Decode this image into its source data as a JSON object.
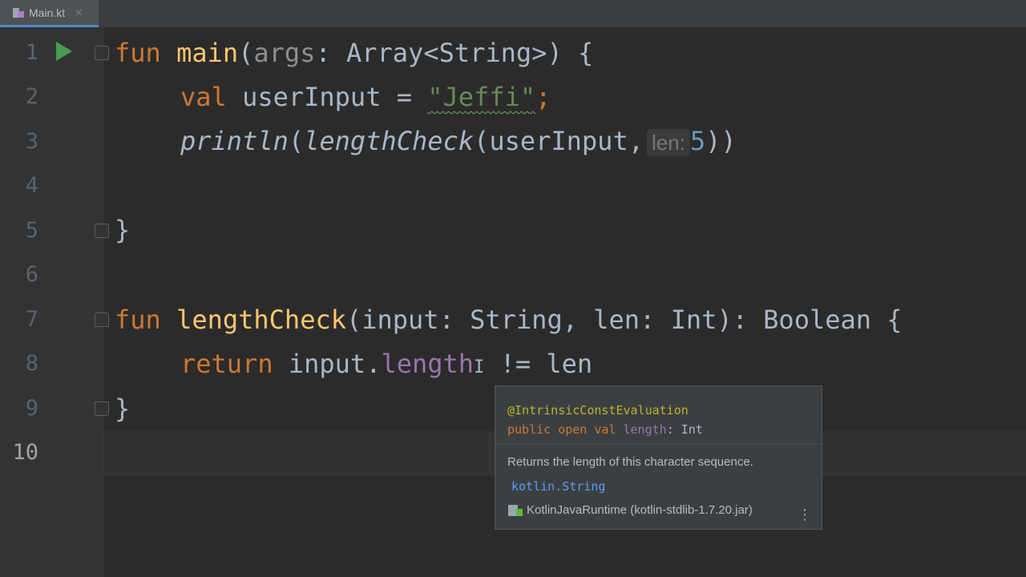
{
  "tab": {
    "label": "Main.kt",
    "close": "✕"
  },
  "gutter": {
    "lines": [
      "1",
      "2",
      "3",
      "4",
      "5",
      "6",
      "7",
      "8",
      "9",
      "10"
    ]
  },
  "code": {
    "l1": {
      "fun": "fun",
      "name": "main",
      "open": "(",
      "param": "args",
      "rest": ": Array<String>) {"
    },
    "l2": {
      "val": "val",
      "rest": " userInput = ",
      "str": "\"Jeffi\"",
      "semi": ";"
    },
    "l3": {
      "println": "println",
      "open1": "(",
      "call": "lengthCheck",
      "open2": "(userInput,",
      "hint": "len:",
      "num": "5",
      "close": "))"
    },
    "l5": {
      "brace": "}"
    },
    "l7": {
      "fun": "fun",
      "name": "lengthCheck",
      "rest": "(input: String, len: Int): Boolean {"
    },
    "l8": {
      "ret": "return",
      "obj": " input.",
      "prop": "length",
      "caret": "I",
      "rest": " != len"
    },
    "l9": {
      "brace": "}"
    }
  },
  "popup": {
    "annotation": "@IntrinsicConstEvaluation",
    "sig_kw": "public open val",
    "sig_prop": "length",
    "sig_rest": ": Int",
    "description": "Returns the length of this character sequence.",
    "package": "kotlin.String",
    "library": "KotlinJavaRuntime (kotlin-stdlib-1.7.20.jar)",
    "more": "⋮"
  },
  "colors": {
    "keyword": "#cc7832",
    "function": "#ffc66d",
    "string": "#6a8759",
    "number": "#6897bb",
    "property": "#9876aa",
    "text": "#a9b7c6",
    "background": "#2b2b2b"
  }
}
